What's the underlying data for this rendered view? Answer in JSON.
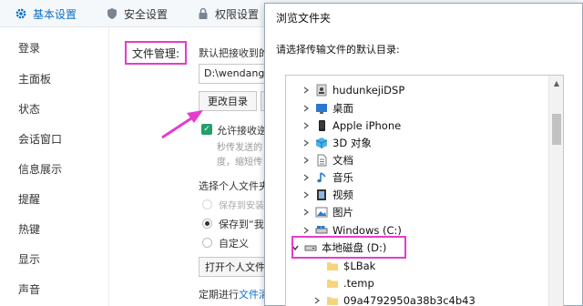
{
  "top_tabs": {
    "basic": "基本设置",
    "security": "安全设置",
    "permission": "权限设置"
  },
  "sidebar": {
    "items": [
      "登录",
      "主面板",
      "状态",
      "会话窗口",
      "信息展示",
      "提醒",
      "热键",
      "显示",
      "声音"
    ]
  },
  "main": {
    "file_mgmt_label": "文件管理:",
    "default_dir_text": "默认把接收到的",
    "path_value": "D:\\wendang\\",
    "change_dir_button": "更改目录",
    "allow_receive": "允许接收逆",
    "desc_line1": "秒传发送的",
    "desc_line2": "度，缩短传",
    "choose_folder": "选择个人文件夹",
    "opt_install": "保存到安装",
    "opt_saveto": "保存到“我",
    "opt_custom": "自定义",
    "open_folder_button": "打开个人文件",
    "cleanup_prefix": "定期进行",
    "cleanup_link": "文件清"
  },
  "dialog": {
    "title": "浏览文件夹",
    "prompt": "请选择传输文件的默认目录:",
    "tree": [
      {
        "label": "hudunkejiDSP",
        "icon": "user-folder-icon"
      },
      {
        "label": "桌面",
        "icon": "desktop-folder-icon"
      },
      {
        "label": "Apple iPhone",
        "icon": "phone-icon"
      },
      {
        "label": "3D 对象",
        "icon": "3d-objects-icon"
      },
      {
        "label": "文档",
        "icon": "documents-icon"
      },
      {
        "label": "音乐",
        "icon": "music-icon"
      },
      {
        "label": "视频",
        "icon": "video-icon"
      },
      {
        "label": "图片",
        "icon": "pictures-icon"
      },
      {
        "label": "Windows (C:)",
        "icon": "drive-icon"
      },
      {
        "label": "本地磁盘 (D:)",
        "icon": "drive-icon"
      },
      {
        "label": "$LBak",
        "icon": "folder-icon"
      },
      {
        "label": ".temp",
        "icon": "folder-icon"
      },
      {
        "label": "09a4792950a38b3c4b43",
        "icon": "folder-icon"
      }
    ]
  },
  "colors": {
    "highlight": "#e43ccd",
    "accent": "#0b6fc4",
    "check": "#23a06a"
  }
}
